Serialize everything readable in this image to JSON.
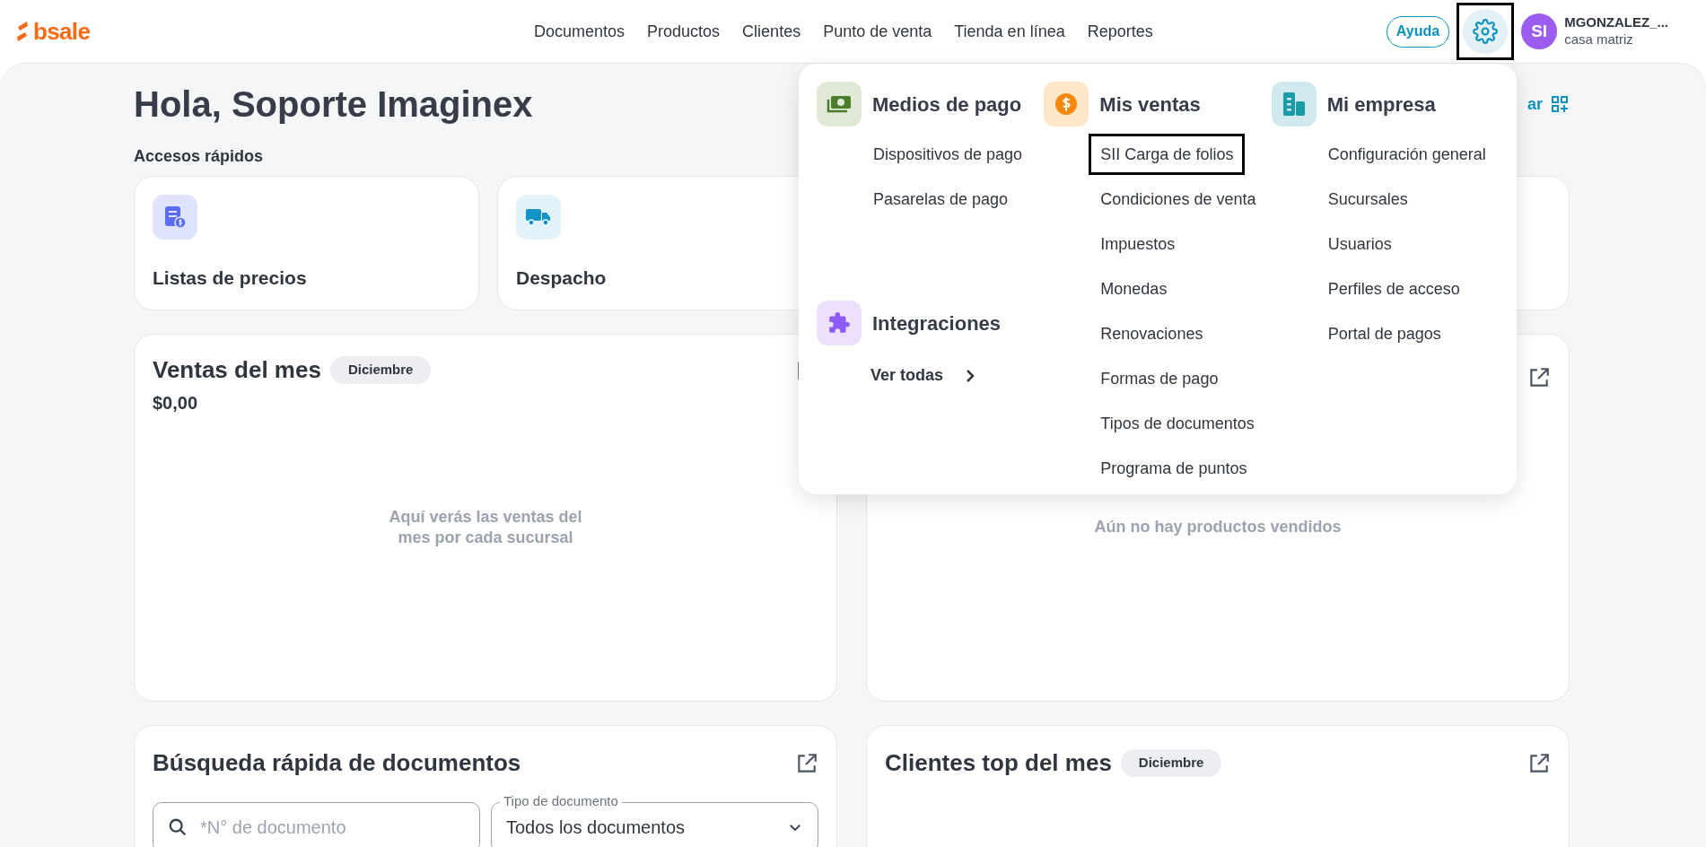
{
  "header": {
    "logo": "bsale",
    "nav": [
      {
        "label": "Documentos"
      },
      {
        "label": "Productos"
      },
      {
        "label": "Clientes"
      },
      {
        "label": "Punto de venta"
      },
      {
        "label": "Tienda en línea"
      },
      {
        "label": "Reportes"
      }
    ],
    "help_button": "Ayuda",
    "settings_highlighted": true,
    "user": {
      "initials": "SI",
      "name": "MGONZALEZ_...",
      "branch": "casa matriz"
    }
  },
  "greeting": "Hola, Soporte Imaginex",
  "customize_link": "ar",
  "quick_access": {
    "title": "Accesos rápidos",
    "items": [
      {
        "label": "Listas de precios",
        "kind": "price-list"
      },
      {
        "label": "Despacho",
        "kind": "truck"
      }
    ]
  },
  "sales_card": {
    "title": "Ventas del mes",
    "month": "Diciembre",
    "total": "$0,00",
    "empty_text": "Aquí verás las ventas del mes por cada sucursal"
  },
  "products_card": {
    "empty_text": "Aún no hay productos vendidos"
  },
  "search_card": {
    "title": "Búsqueda rápida de documentos",
    "search_placeholder": "*N° de documento",
    "doc_type_label": "Tipo de documento",
    "doc_type_value": "Todos los documentos"
  },
  "clients_card": {
    "title": "Clientes top del mes",
    "month": "Diciembre"
  },
  "settings_menu": {
    "columns": [
      [
        {
          "title": "Medios de pago",
          "kind": "money",
          "color": "#dfe9d6",
          "items": [
            {
              "label": "Dispositivos de pago",
              "highlighted": false
            },
            {
              "label": "Pasarelas de pago",
              "highlighted": false
            }
          ]
        },
        {
          "title": "Integraciones",
          "kind": "puzzle",
          "color": "#ece0fd",
          "link": "Ver todas"
        }
      ],
      [
        {
          "title": "Mis ventas",
          "kind": "coin",
          "color": "#fde6c9",
          "items": [
            {
              "label": "SII Carga de folios",
              "highlighted": true
            },
            {
              "label": "Condiciones de venta",
              "highlighted": false
            },
            {
              "label": "Impuestos",
              "highlighted": false
            },
            {
              "label": "Monedas",
              "highlighted": false
            },
            {
              "label": "Renovaciones",
              "highlighted": false
            },
            {
              "label": "Formas de pago",
              "highlighted": false
            },
            {
              "label": "Tipos de documentos",
              "highlighted": false
            },
            {
              "label": "Programa de puntos",
              "highlighted": false
            }
          ]
        }
      ],
      [
        {
          "title": "Mi empresa",
          "kind": "building",
          "color": "#cfe9ec",
          "items": [
            {
              "label": "Configuración general",
              "highlighted": false
            },
            {
              "label": "Sucursales",
              "highlighted": false
            },
            {
              "label": "Usuarios",
              "highlighted": false
            },
            {
              "label": "Perfiles de acceso",
              "highlighted": false
            },
            {
              "label": "Portal de pagos",
              "highlighted": false
            }
          ]
        }
      ]
    ]
  }
}
